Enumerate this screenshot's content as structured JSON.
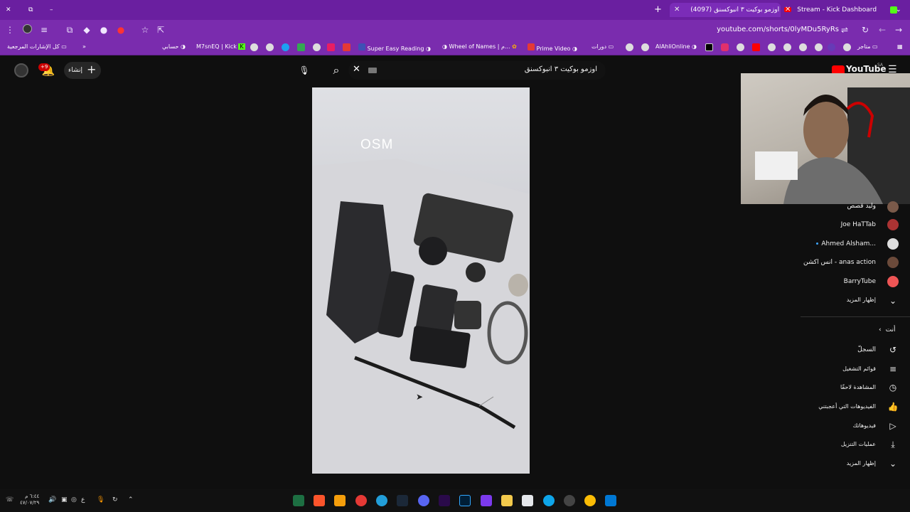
{
  "tabs": [
    {
      "label": "Stream - Kick Dashboard"
    },
    {
      "label": "(4097) اوزمو بوكيت ٣ انبوكسنق"
    }
  ],
  "toolbar": {
    "url": "youtube.com/shorts/0lyMDu5RyRs"
  },
  "bookmarks": {
    "all_bookmarks": "كل الإشارات المرجعية",
    "items": [
      "حسابي",
      "M7snEQ | Kick",
      "Super Easy Reading",
      "Wheel of Names | م...",
      "Prime Video",
      "دورات",
      "AlAhliOnline",
      "متاجر"
    ]
  },
  "header": {
    "logo": "YouTube",
    "region": "SA",
    "search_value": "اوزمو بوكيت ٣ انبوكسنق",
    "create_label": "إنشاء",
    "notification_count": "+9"
  },
  "video": {
    "overlay_text": "OSM"
  },
  "sidebar": {
    "subs": [
      {
        "name": "وليد قصص"
      },
      {
        "name": "Joe HaTTab"
      },
      {
        "name": "Ahmed Alsham..."
      },
      {
        "name": "انس اكشن - anas action"
      },
      {
        "name": "BarryTube"
      }
    ],
    "show_more_1": "إظهار المزيد",
    "you_label": "أنت",
    "you_items": [
      {
        "label": "السجلّ",
        "icon": "history-icon"
      },
      {
        "label": "قوائم التشغيل",
        "icon": "playlist-icon"
      },
      {
        "label": "المشاهدة لاحقًا",
        "icon": "clock-icon"
      },
      {
        "label": "الفيديوهات التي أعجبتني",
        "icon": "thumbs-up-icon"
      },
      {
        "label": "فيديوهاتك",
        "icon": "play-square-icon"
      },
      {
        "label": "عمليات التنزيل",
        "icon": "download-icon"
      }
    ],
    "show_more_2": "إظهار المزيد"
  },
  "taskbar": {
    "time": "٦:٤٤ م",
    "date": "٤٧/٠٧/٢٩",
    "lang": "ع"
  }
}
